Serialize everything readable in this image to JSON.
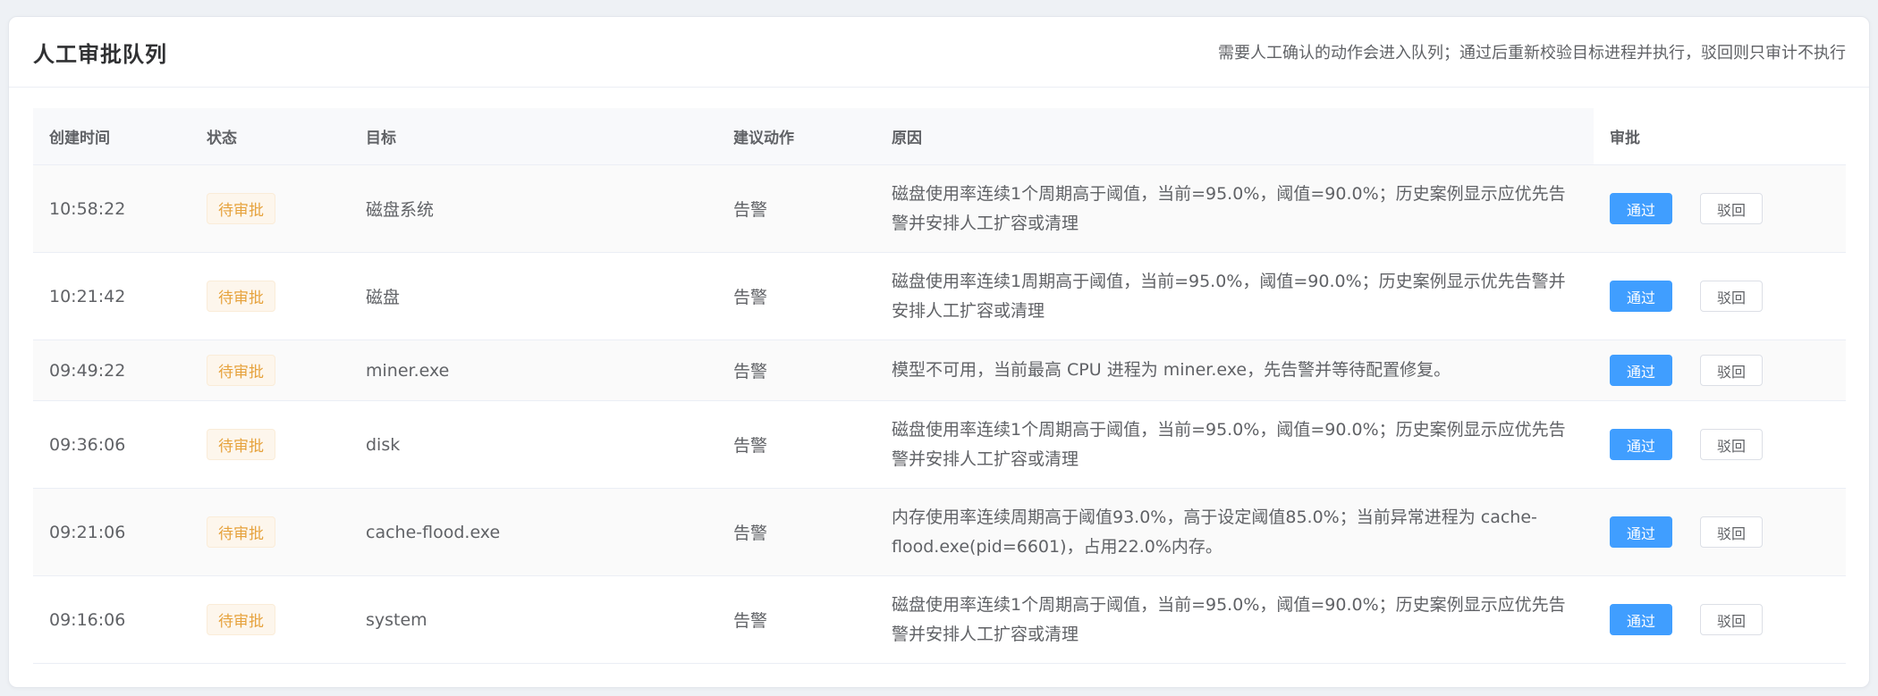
{
  "panel": {
    "title": "人工审批队列",
    "description": "需要人工确认的动作会进入队列；通过后重新校验目标进程并执行，驳回则只审计不执行"
  },
  "table": {
    "columns": [
      "创建时间",
      "状态",
      "目标",
      "建议动作",
      "原因",
      "审批"
    ],
    "approve_label": "通过",
    "reject_label": "驳回",
    "rows": [
      {
        "time": "10:58:22",
        "status": "待审批",
        "target": "磁盘系统",
        "action": "告警",
        "reason": "磁盘使用率连续1个周期高于阈值，当前=95.0%，阈值=90.0%；历史案例显示应优先告警并安排人工扩容或清理"
      },
      {
        "time": "10:21:42",
        "status": "待审批",
        "target": "磁盘",
        "action": "告警",
        "reason": "磁盘使用率连续1周期高于阈值，当前=95.0%，阈值=90.0%；历史案例显示优先告警并安排人工扩容或清理"
      },
      {
        "time": "09:49:22",
        "status": "待审批",
        "target": "miner.exe",
        "action": "告警",
        "reason": "模型不可用，当前最高 CPU 进程为 miner.exe，先告警并等待配置修复。"
      },
      {
        "time": "09:36:06",
        "status": "待审批",
        "target": "disk",
        "action": "告警",
        "reason": "磁盘使用率连续1个周期高于阈值，当前=95.0%，阈值=90.0%；历史案例显示应优先告警并安排人工扩容或清理"
      },
      {
        "time": "09:21:06",
        "status": "待审批",
        "target": "cache-flood.exe",
        "action": "告警",
        "reason": "内存使用率连续周期高于阈值93.0%，高于设定阈值85.0%；当前异常进程为 cache-flood.exe(pid=6601)，占用22.0%内存。"
      },
      {
        "time": "09:16:06",
        "status": "待审批",
        "target": "system",
        "action": "告警",
        "reason": "磁盘使用率连续1个周期高于阈值，当前=95.0%，阈值=90.0%；历史案例显示应优先告警并安排人工扩容或清理"
      }
    ]
  }
}
